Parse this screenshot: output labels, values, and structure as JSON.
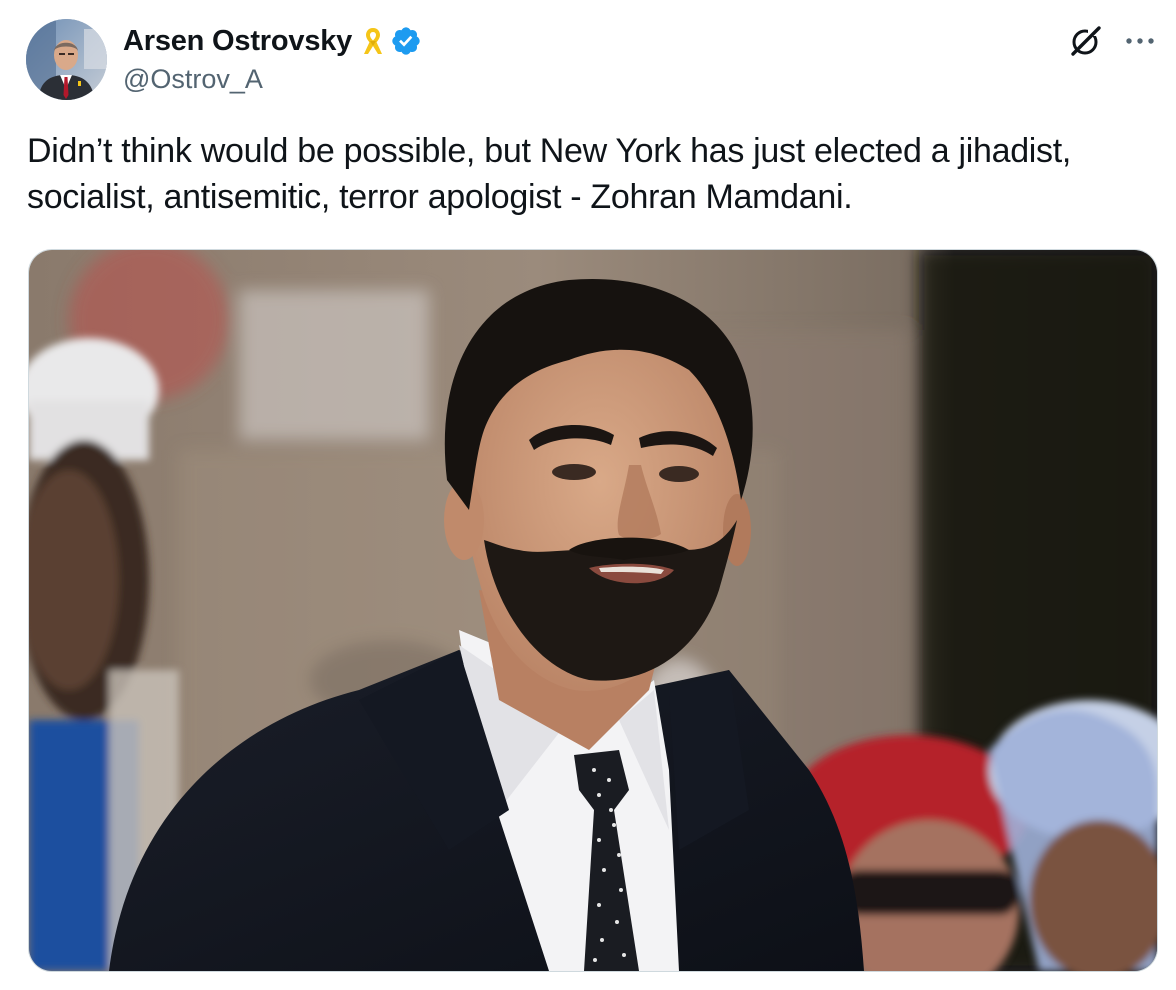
{
  "author": {
    "display_name": "Arsen Ostrovsky",
    "handle": "@Ostrov_A",
    "avatar_icon": "user-avatar",
    "badges": [
      "yellow-ribbon-icon",
      "verified-badge-icon"
    ]
  },
  "header_actions": {
    "grok_icon": "grok-icon",
    "more_icon": "more-options-icon"
  },
  "tweet": {
    "text": "Didn’t think would be possible, but New York has just elected a jihadist, socialist, antisemitic, terror apologist - Zohran Mamdani."
  },
  "media": {
    "type": "photo"
  },
  "colors": {
    "verified": "#1d9bf0",
    "ribbon": "#f5c518",
    "handle": "#536471",
    "text": "#0f1419",
    "border": "#cfd9de"
  }
}
